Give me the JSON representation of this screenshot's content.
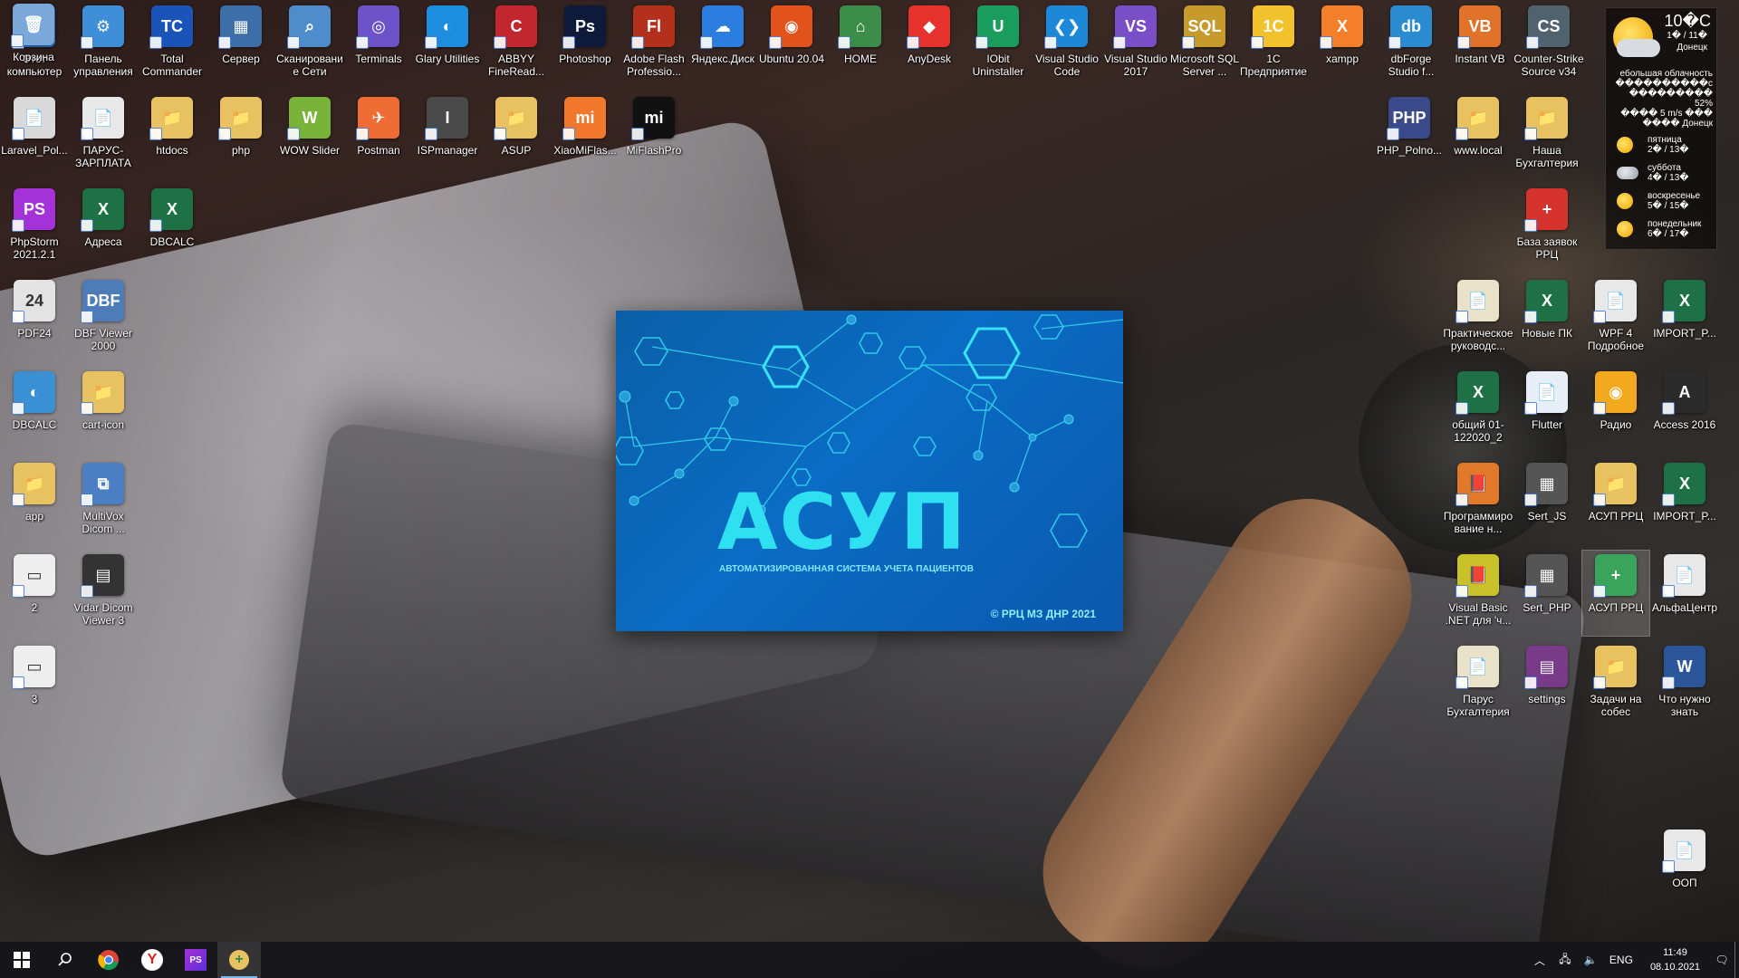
{
  "desktop": {
    "icons": [
      {
        "label": "Этот компьютер",
        "color": "#2a7bd6",
        "glyph": "🖥"
      },
      {
        "label": "Панель управления",
        "color": "#3f8fd8",
        "glyph": "⚙"
      },
      {
        "label": "Total Commander",
        "color": "#1a54b8",
        "glyph": "TC"
      },
      {
        "label": "Сервер",
        "color": "#3c6ea8",
        "glyph": "▦"
      },
      {
        "label": "Сканирование Сети",
        "color": "#4e8ccc",
        "glyph": "⌕"
      },
      {
        "label": "Terminals",
        "color": "#6b52c9",
        "glyph": "◎"
      },
      {
        "label": "Glary Utilities",
        "color": "#1d8de0",
        "glyph": "◐"
      },
      {
        "label": "ABBYY FineRead...",
        "color": "#c2262e",
        "glyph": "C"
      },
      {
        "label": "Photoshop",
        "color": "#0d1a3a",
        "glyph": "Ps"
      },
      {
        "label": "Adobe Flash Professio...",
        "color": "#b3311c",
        "glyph": "Fl"
      },
      {
        "label": "Яндекс.Диск",
        "color": "#2b7de0",
        "glyph": "☁"
      },
      {
        "label": "Ubuntu 20.04",
        "color": "#e2521b",
        "glyph": "◉"
      },
      {
        "label": "HOME",
        "color": "#3c8d49",
        "glyph": "⌂"
      },
      {
        "label": "AnyDesk",
        "color": "#e6322d",
        "glyph": "◆"
      },
      {
        "label": "IObit Uninstaller",
        "color": "#1a9c5c",
        "glyph": "U"
      },
      {
        "label": "Visual Studio Code",
        "color": "#1e88d8",
        "glyph": "❮❯"
      },
      {
        "label": "Visual Studio 2017",
        "color": "#7a4ec6",
        "glyph": "VS"
      },
      {
        "label": "Microsoft SQL Server ...",
        "color": "#c79a2c",
        "glyph": "SQL"
      },
      {
        "label": "1С Предприятие",
        "color": "#f1c22c",
        "glyph": "1С"
      },
      {
        "label": "xampp",
        "color": "#f37f2a",
        "glyph": "X"
      },
      {
        "label": "dbForge Studio f...",
        "color": "#2a8bd1",
        "glyph": "db"
      },
      {
        "label": "Instant VB",
        "color": "#e0722a",
        "glyph": "VB"
      },
      {
        "label": "Counter-Strike Source v34",
        "color": "#51626f",
        "glyph": "CS"
      },
      {
        "label": "Laravel_Pol...",
        "color": "#d9d9d9",
        "glyph": "📄"
      },
      {
        "label": "ПАРУС-ЗАРПЛАТА",
        "color": "#e8e8e8",
        "glyph": "📄"
      },
      {
        "label": "htdocs",
        "color": "#e8c160",
        "glyph": "📁"
      },
      {
        "label": "php",
        "color": "#e8c160",
        "glyph": "📁"
      },
      {
        "label": "WOW Slider",
        "color": "#7ab33a",
        "glyph": "W"
      },
      {
        "label": "Postman",
        "color": "#ef6c35",
        "glyph": "✈"
      },
      {
        "label": "ISPmanager",
        "color": "#4a4a4a",
        "glyph": "I"
      },
      {
        "label": "ASUP",
        "color": "#e8c160",
        "glyph": "📁"
      },
      {
        "label": "XiaoMiFlas...",
        "color": "#f2792b",
        "glyph": "mi"
      },
      {
        "label": "MiFlashPro",
        "color": "#111111",
        "glyph": "mi"
      },
      {
        "label": "PhpStorm 2021.2.1",
        "color": "#a531d8",
        "glyph": "PS"
      },
      {
        "label": "Адреса",
        "color": "#1e7145",
        "glyph": "X"
      },
      {
        "label": "DBCALC",
        "color": "#1e7145",
        "glyph": "X"
      },
      {
        "label": "PDF24",
        "color": "#e3e3e3",
        "glyph": "24"
      },
      {
        "label": "DBF Viewer 2000",
        "color": "#4d7cb8",
        "glyph": "DBF"
      },
      {
        "label": "DBCALC",
        "color": "#3b8fd3",
        "glyph": "◐"
      },
      {
        "label": "cart-icon",
        "color": "#e8c160",
        "glyph": "📁"
      },
      {
        "label": "app",
        "color": "#e8c160",
        "glyph": "📁"
      },
      {
        "label": "MultiVox Dicom ...",
        "color": "#4b7ec2",
        "glyph": "⧉"
      },
      {
        "label": "2",
        "color": "#eeeeee",
        "glyph": "▭"
      },
      {
        "label": "Vidar Dicom Viewer 3",
        "color": "#333333",
        "glyph": "▤"
      },
      {
        "label": "3",
        "color": "#eeeeee",
        "glyph": "▭"
      },
      {
        "label": "PHP_Polno...",
        "color": "#3a4a8a",
        "glyph": "PHP"
      },
      {
        "label": "www.local",
        "color": "#e8c160",
        "glyph": "📁"
      },
      {
        "label": "Наша Бухгалтерия",
        "color": "#e8c160",
        "glyph": "📁"
      },
      {
        "label": "База заявок РРЦ",
        "color": "#d7332e",
        "glyph": "+"
      },
      {
        "label": "Практическое руководс...",
        "color": "#e9e2c8",
        "glyph": "📄"
      },
      {
        "label": "Новые ПК",
        "color": "#1e7145",
        "glyph": "X"
      },
      {
        "label": "WPF 4 Подробное руков...",
        "color": "#e8e8e8",
        "glyph": "📄"
      },
      {
        "label": "IMPORT_P...",
        "color": "#1e7145",
        "glyph": "X"
      },
      {
        "label": "общий 01-122020_2",
        "color": "#1e7145",
        "glyph": "X"
      },
      {
        "label": "Flutter",
        "color": "#e7eef7",
        "glyph": "📄"
      },
      {
        "label": "Радио",
        "color": "#f2a91e",
        "glyph": "◉"
      },
      {
        "label": "Access 2016",
        "color": "#2b2b2b",
        "glyph": "A"
      },
      {
        "label": "Программирование н...",
        "color": "#e07a2a",
        "glyph": "📕"
      },
      {
        "label": "Sert_JS",
        "color": "#555555",
        "glyph": "▦"
      },
      {
        "label": "АСУП РРЦ",
        "color": "#e8c160",
        "glyph": "📁"
      },
      {
        "label": "IMPORT_P...",
        "color": "#1e7145",
        "glyph": "X"
      },
      {
        "label": "Visual Basic .NET для 'ч...",
        "color": "#c9c12a",
        "glyph": "📕"
      },
      {
        "label": "Sert_PHP",
        "color": "#555555",
        "glyph": "▦"
      },
      {
        "label": "АСУП РРЦ",
        "color": "#3aa45a",
        "glyph": "+"
      },
      {
        "label": "АльфаЦентр",
        "color": "#e8e8e8",
        "glyph": "📄"
      },
      {
        "label": "Парус Бухгалтерия",
        "color": "#e9e2c8",
        "glyph": "📄"
      },
      {
        "label": "settings",
        "color": "#7a3a8a",
        "glyph": "▤"
      },
      {
        "label": "Задачи на собес",
        "color": "#e8c160",
        "glyph": "📁"
      },
      {
        "label": "Что нужно знать",
        "color": "#2b579a",
        "glyph": "W"
      },
      {
        "label": "ООП",
        "color": "#e8e8e8",
        "glyph": "📄"
      },
      {
        "label": "Корзина",
        "color": "#7aa8d8",
        "glyph": "🗑"
      }
    ]
  },
  "weather": {
    "temp": "10�C",
    "range": "1� / 11�",
    "city": "Донецк",
    "desc_line1": "ебольшая облачность",
    "desc_line2": "����������c  ���������  52%",
    "desc_line3": "����  5 m/s ���",
    "desc_line4": "����  Донецк",
    "forecast": [
      {
        "day": "пятница",
        "temps": "2� / 13�",
        "kind": "sun"
      },
      {
        "day": "суббота",
        "temps": "4� / 13�",
        "kind": "cloud"
      },
      {
        "day": "воскресенье",
        "temps": "5� / 15�",
        "kind": "sun"
      },
      {
        "day": "понедельник",
        "temps": "6� / 17�",
        "kind": "sun"
      }
    ]
  },
  "splash": {
    "title": "АСУП",
    "subtitle": "АВТОМАТИЗИРОВАННАЯ СИСТЕМА УЧЕТА ПАЦИЕНТОВ",
    "copyright": "© РРЦ МЗ ДНР 2021"
  },
  "taskbar": {
    "apps": [
      {
        "name": "chrome",
        "label": "",
        "color": "#e3432e"
      },
      {
        "name": "yandex",
        "label": "Y",
        "color": "#ffffff"
      },
      {
        "name": "phpstorm",
        "label": "PS",
        "color": "#a531d8"
      },
      {
        "name": "asup",
        "label": "+",
        "color": "#3aa45a"
      }
    ],
    "lang": "ENG",
    "time": "11:49",
    "date": "08.10.2021"
  }
}
